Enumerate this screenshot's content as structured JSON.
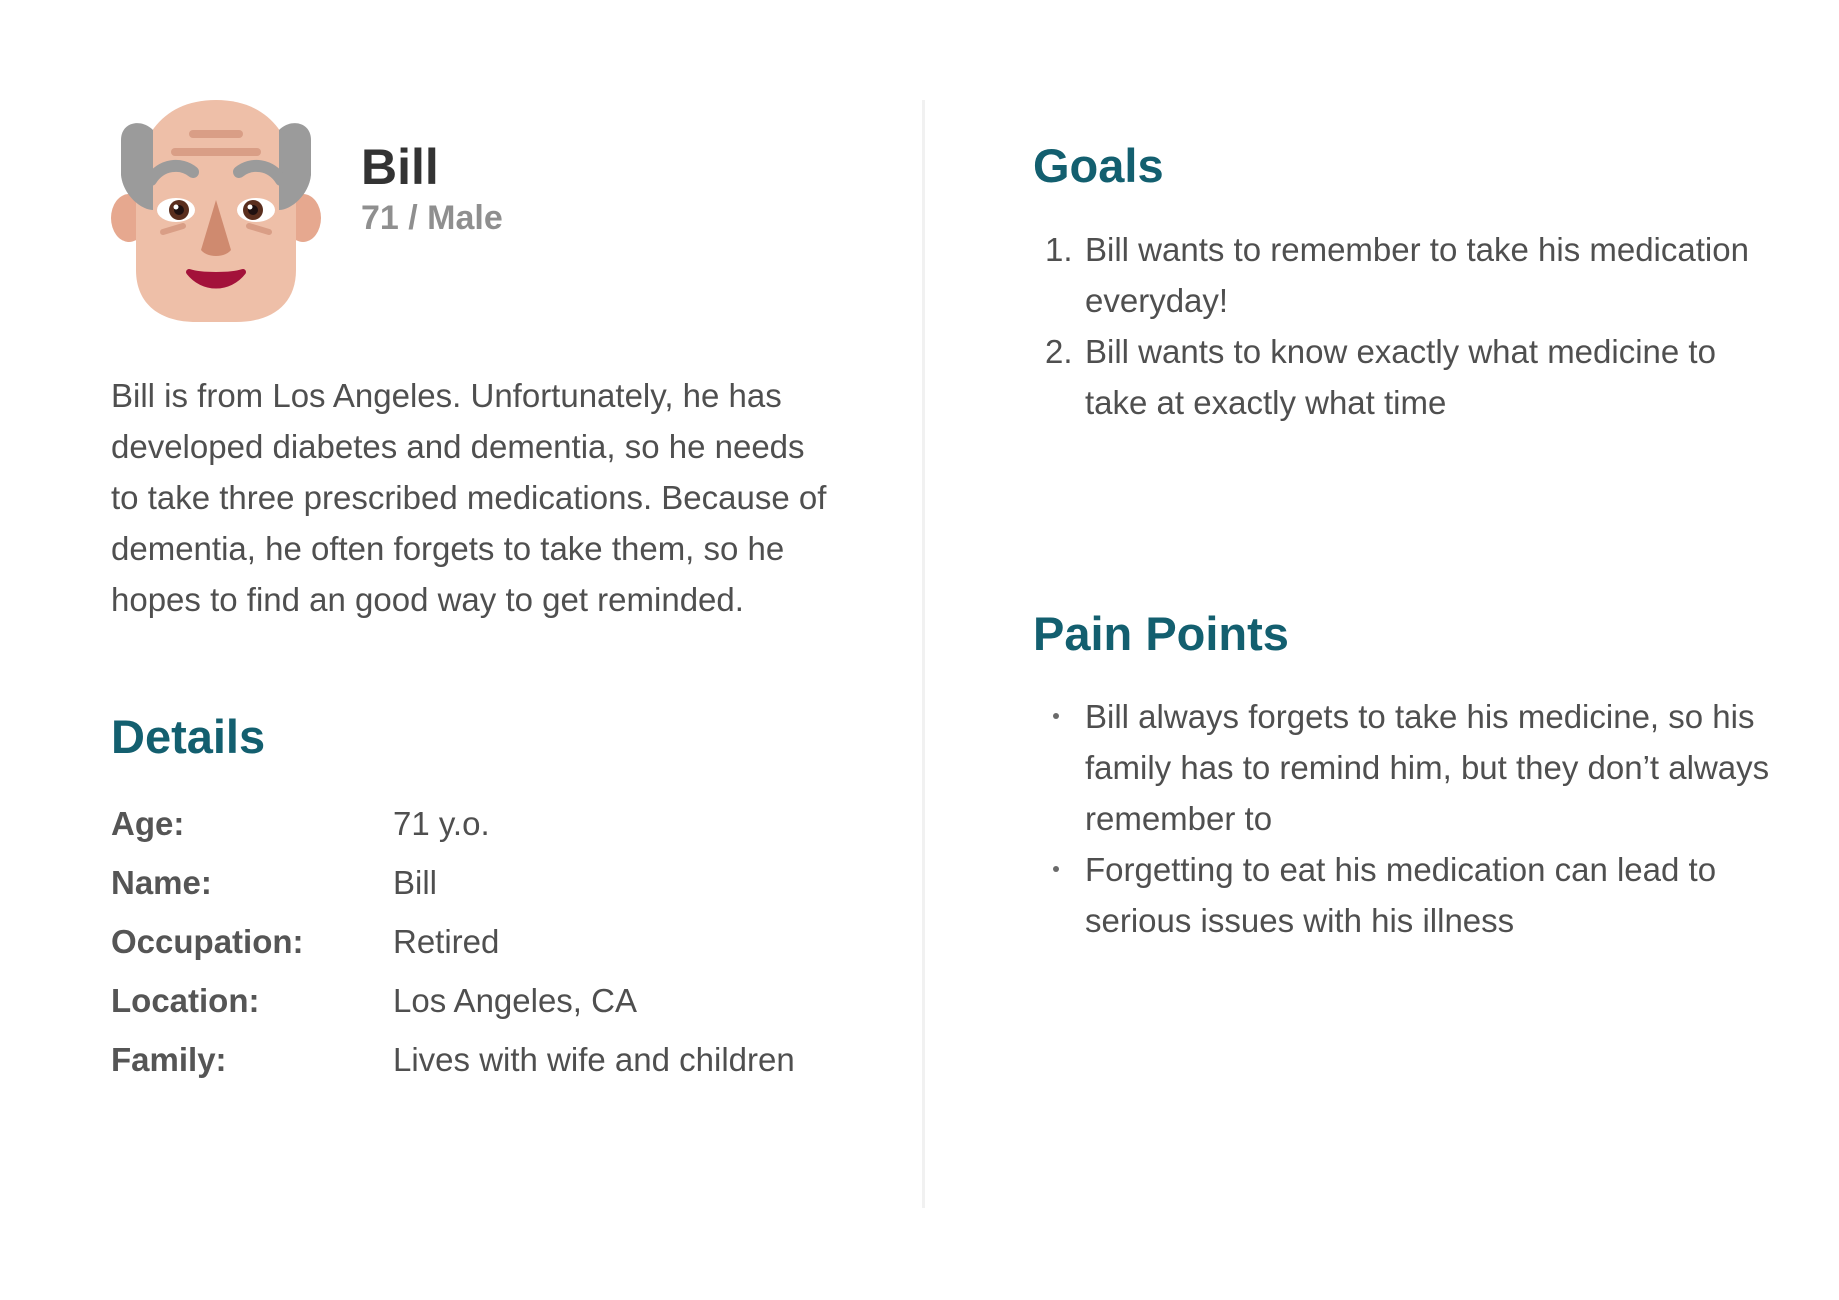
{
  "persona": {
    "name": "Bill",
    "subtitle": "71 / Male",
    "avatar_icon": "elderly-man-face-icon",
    "bio": "Bill is from Los Angeles. Unfortunately, he has developed diabetes and dementia, so he needs to take three prescribed medications. Because of dementia, he often forgets to take them, so he hopes to find an good way to get reminded."
  },
  "details": {
    "title": "Details",
    "rows": [
      {
        "label": "Age:",
        "value": "71 y.o."
      },
      {
        "label": "Name:",
        "value": "Bill"
      },
      {
        "label": "Occupation:",
        "value": "Retired"
      },
      {
        "label": "Location:",
        "value": "Los Angeles, CA"
      },
      {
        "label": "Family:",
        "value": "Lives with wife and children"
      }
    ]
  },
  "goals": {
    "title": "Goals",
    "items": [
      {
        "marker": "1.",
        "text": "Bill wants to remember to take his medication everyday!"
      },
      {
        "marker": "2.",
        "text": "Bill wants to know exactly what medicine to take at exactly what time"
      }
    ]
  },
  "pain_points": {
    "title": "Pain Points",
    "items": [
      {
        "text": "Bill always forgets to take his medicine, so his family has to remind him, but they don’t always remember to"
      },
      {
        "text": "Forgetting to eat his medication can lead to serious issues with his illness"
      }
    ]
  },
  "colors": {
    "heading": "#135f6f",
    "skin": "#eebfa8",
    "hair": "#9b9b9b"
  }
}
